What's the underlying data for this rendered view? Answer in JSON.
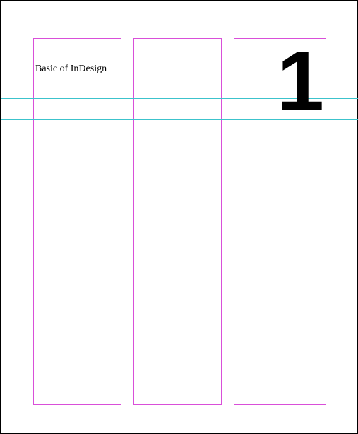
{
  "document": {
    "title": "Basic of InDesign",
    "chapter_number": "1"
  }
}
